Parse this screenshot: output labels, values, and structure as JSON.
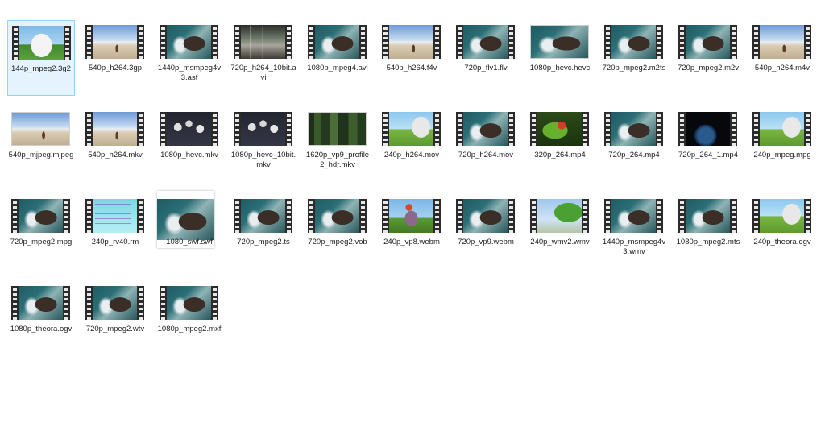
{
  "items": [
    {
      "name": "144p_mpeg2.3g2",
      "thumb": "bunny1",
      "style": "film",
      "selected": true
    },
    {
      "name": "540p_h264.3gp",
      "thumb": "beach",
      "style": "film"
    },
    {
      "name": "1440p_msmpeg4v3.asf",
      "thumb": "ocean",
      "style": "film"
    },
    {
      "name": "720p_h264_10bit.avi",
      "thumb": "room",
      "style": "film"
    },
    {
      "name": "1080p_mpeg4.avi",
      "thumb": "ocean",
      "style": "film"
    },
    {
      "name": "540p_h264.f4v",
      "thumb": "beach",
      "style": "film"
    },
    {
      "name": "720p_flv1.flv",
      "thumb": "ocean",
      "style": "film"
    },
    {
      "name": "1080p_hevc.hevc",
      "thumb": "ocean",
      "style": "plain"
    },
    {
      "name": "720p_mpeg2.m2ts",
      "thumb": "ocean",
      "style": "film"
    },
    {
      "name": "720p_mpeg2.m2v",
      "thumb": "ocean",
      "style": "film"
    },
    {
      "name": "540p_h264.m4v",
      "thumb": "beach",
      "style": "film"
    },
    {
      "name": "540p_mjpeg.mjpeg",
      "thumb": "beach",
      "style": "plain"
    },
    {
      "name": "540p_h264.mkv",
      "thumb": "beach",
      "style": "film"
    },
    {
      "name": "1080p_hevc.mkv",
      "thumb": "flowers",
      "style": "film"
    },
    {
      "name": "1080p_hevc_10bit.mkv",
      "thumb": "flowers",
      "style": "film"
    },
    {
      "name": "1620p_vp9_profile2_hdr.mkv",
      "thumb": "forest",
      "style": "plain"
    },
    {
      "name": "240p_h264.mov",
      "thumb": "bunny2",
      "style": "film"
    },
    {
      "name": "720p_h264.mov",
      "thumb": "ocean",
      "style": "film"
    },
    {
      "name": "320p_264.mp4",
      "thumb": "green",
      "style": "film"
    },
    {
      "name": "720p_264.mp4",
      "thumb": "ocean",
      "style": "film"
    },
    {
      "name": "720p_264_1.mp4",
      "thumb": "earth",
      "style": "film"
    },
    {
      "name": "240p_mpeg.mpg",
      "thumb": "bunny2",
      "style": "film"
    },
    {
      "name": "720p_mpeg2.mpg",
      "thumb": "ocean",
      "style": "film"
    },
    {
      "name": "240p_rv40.rm",
      "thumb": "slide",
      "style": "film"
    },
    {
      "name": "1080_swf.swf",
      "thumb": "ocean",
      "style": "card"
    },
    {
      "name": "720p_mpeg2.ts",
      "thumb": "ocean",
      "style": "film"
    },
    {
      "name": "720p_mpeg2.vob",
      "thumb": "ocean",
      "style": "film"
    },
    {
      "name": "240p_vp8.webm",
      "thumb": "vp8",
      "style": "film"
    },
    {
      "name": "720p_vp9.webm",
      "thumb": "ocean",
      "style": "film"
    },
    {
      "name": "240p_wmv2.wmv",
      "thumb": "tree",
      "style": "film"
    },
    {
      "name": "1440p_msmpeg4v3.wmv",
      "thumb": "ocean",
      "style": "film"
    },
    {
      "name": "1080p_mpeg2.mts",
      "thumb": "ocean",
      "style": "film"
    },
    {
      "name": "240p_theora.ogv",
      "thumb": "bunny2",
      "style": "film"
    },
    {
      "name": "1080p_theora.ogv",
      "thumb": "ocean",
      "style": "film"
    },
    {
      "name": "720p_mpeg2.wtv",
      "thumb": "ocean",
      "style": "film"
    },
    {
      "name": "1080p_mpeg2.mxf",
      "thumb": "ocean",
      "style": "film"
    }
  ]
}
